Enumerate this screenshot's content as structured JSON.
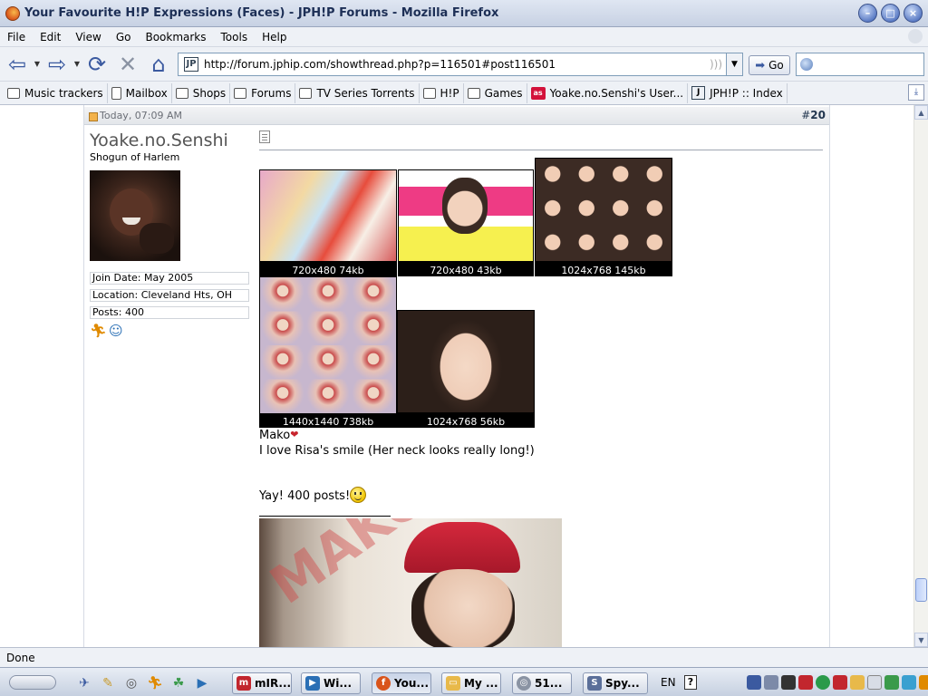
{
  "window": {
    "title": "Your Favourite H!P Expressions (Faces) - JPH!P Forums - Mozilla Firefox"
  },
  "menu": [
    "File",
    "Edit",
    "View",
    "Go",
    "Bookmarks",
    "Tools",
    "Help"
  ],
  "navbar": {
    "url": "http://forum.jphip.com/showthread.php?p=116501#post116501",
    "go_label": "Go"
  },
  "bookmarks": [
    {
      "label": "Music trackers",
      "icon": "folder-icon"
    },
    {
      "label": "Mailbox",
      "icon": "page-icon"
    },
    {
      "label": "Shops",
      "icon": "folder-icon"
    },
    {
      "label": "Forums",
      "icon": "folder-icon"
    },
    {
      "label": "TV Series Torrents",
      "icon": "folder-icon"
    },
    {
      "label": "H!P",
      "icon": "folder-icon"
    },
    {
      "label": "Games",
      "icon": "folder-icon"
    },
    {
      "label": "Yoake.no.Senshi's User...",
      "icon": "lastfm-icon"
    },
    {
      "label": "JPH!P :: Index",
      "icon": "jphip-icon"
    }
  ],
  "post": {
    "date": "Today, 07:09 AM",
    "number_prefix": "#",
    "number": "20",
    "user": {
      "name": "Yoake.no.Senshi",
      "title": "Shogun of Harlem",
      "join_date": "Join Date: May 2005",
      "location": "Location: Cleveland Hts, OH",
      "posts": "Posts: 400"
    },
    "thumbnails": [
      {
        "caption": "720x480 74kb"
      },
      {
        "caption": "720x480 43kb"
      },
      {
        "caption": "1024x768 145kb"
      },
      {
        "caption": "1440x1440 738kb"
      },
      {
        "caption": "1024x768 56kb"
      }
    ],
    "text_line1": "Mako",
    "text_line2": "I love Risa's smile (Her neck looks really long!)",
    "text_line3": "Yay! 400 posts!",
    "signature_image_text": "MAKOTO"
  },
  "status": "Done",
  "taskbar": {
    "items": [
      "mIR...",
      "Wi...",
      "You...",
      "My ...",
      "51...",
      "Spy..."
    ],
    "lang": "EN"
  },
  "colors": {
    "titlebar": "#c7d1e3",
    "chrome": "#eef1f6",
    "accent": "#3b5aa0"
  }
}
